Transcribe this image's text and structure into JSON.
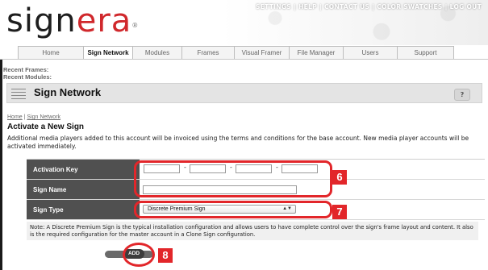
{
  "logo": {
    "part1": "sign",
    "part2": "era",
    "reg": "®"
  },
  "top_nav": [
    "SETTINGS",
    "HELP",
    "CONTACT US",
    "COLOR SWATCHES",
    "LOG OUT"
  ],
  "tabs": [
    {
      "label": "Home",
      "active": false
    },
    {
      "label": "Sign Network",
      "active": true
    },
    {
      "label": "Modules",
      "active": false
    },
    {
      "label": "Frames",
      "active": false
    },
    {
      "label": "Visual Framer",
      "active": false
    },
    {
      "label": "File Manager",
      "active": false
    },
    {
      "label": "Users",
      "active": false
    },
    {
      "label": "Support",
      "active": false
    }
  ],
  "recent": {
    "frames": "Recent Frames:",
    "modules": "Recent Modules:"
  },
  "banner": {
    "title": "Sign Network",
    "help": "?"
  },
  "breadcrumb": {
    "home": "Home",
    "sep": " | ",
    "current": "Sign Network"
  },
  "heading": "Activate a New Sign",
  "description": "Additional media players added to this account will be invoiced using the terms and conditions for the base account. New media player accounts will be activated immediately.",
  "form": {
    "activation_key_label": "Activation Key",
    "sign_name_label": "Sign Name",
    "sign_type_label": "Sign Type",
    "sign_type_value": "Discrete Premium Sign",
    "key_separator": "-"
  },
  "note": "Note: A Discrete Premium Sign is the typical installation configuration and allows users to have complete control over the sign's frame layout and content. It also is the required configuration for the master account in a Clone Sign configuration.",
  "add_button": "ADD",
  "annotations": {
    "b6": "6",
    "b7": "7",
    "b8": "8"
  },
  "colors": {
    "accent_red": "#e2262a",
    "logo_red": "#d0282c",
    "label_bg": "#505050"
  }
}
